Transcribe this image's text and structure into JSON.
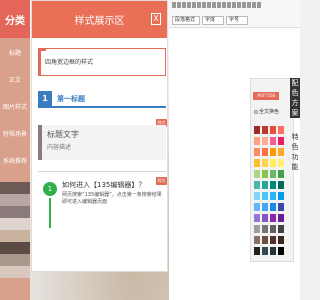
{
  "sidebar": {
    "title": "分类",
    "items": [
      "标题",
      "正文",
      "图片样式",
      "特殊场景",
      "系统推荐"
    ],
    "swatch_colors": [
      "#6d5b56",
      "#b8a6a2",
      "#8b7a7a",
      "#e0d4cf",
      "#c9b39f",
      "#5c4a44",
      "#a8988c",
      "#d7c7bc"
    ]
  },
  "panel": {
    "title": "样式展示区",
    "close_glyph": "X",
    "styles": {
      "border_text": "四角宽边框的样式",
      "heading_num": "1",
      "heading_text": "第一标题",
      "title_text": "标题文字",
      "desc_text": "内容描述",
      "tag_label": "样式",
      "step_num": "1",
      "step_title": "如何进入【135编辑器】？",
      "step_desc": "网页搜索“135编辑器”，点击第一条搜索结果即可进入编辑器页面"
    }
  },
  "editor": {
    "font_size": "段落格式",
    "font_family": "字体",
    "font_px": "字号"
  },
  "palette": {
    "hex": "#EF7560",
    "apply_all": "全文换色",
    "menu_color": "配色方案",
    "menu_special": "特色功能",
    "colors": [
      [
        "#9e2a2a",
        "#c0392b",
        "#e74c3c",
        "#ff6f61"
      ],
      [
        "#ff9e80",
        "#ffab91",
        "#f06292",
        "#e91e63"
      ],
      [
        "#ff8a65",
        "#ff7043",
        "#ff9800",
        "#ffa726"
      ],
      [
        "#fbc02d",
        "#ffd54f",
        "#ffee58",
        "#fff176"
      ],
      [
        "#aed581",
        "#8bc34a",
        "#66bb6a",
        "#43a047"
      ],
      [
        "#4db6ac",
        "#26a69a",
        "#00897b",
        "#00695c"
      ],
      [
        "#81d4fa",
        "#4fc3f7",
        "#29b6f6",
        "#039be5"
      ],
      [
        "#64b5f6",
        "#42a5f5",
        "#1e88e5",
        "#3949ab"
      ],
      [
        "#9575cd",
        "#7e57c2",
        "#8e24aa",
        "#6a1b9a"
      ],
      [
        "#9e9e9e",
        "#757575",
        "#616161",
        "#424242"
      ],
      [
        "#8d6e63",
        "#6d4c41",
        "#4e342e",
        "#3e2723"
      ],
      [
        "#212121",
        "#37474f",
        "#263238",
        "#000000"
      ]
    ]
  }
}
